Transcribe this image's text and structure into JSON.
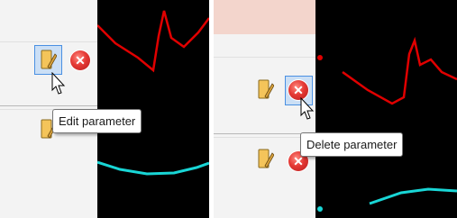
{
  "left": {
    "edit_icon": "pencil-edit-icon",
    "delete_icon": "delete-x-icon",
    "tooltip": "Edit parameter"
  },
  "right": {
    "edit_icon": "pencil-edit-icon",
    "delete_icon": "delete-x-icon",
    "tooltip": "Delete parameter"
  },
  "colors": {
    "signal_red": "#e00000",
    "signal_cyan": "#19d6d6",
    "plot_background": "#000000",
    "sidebar_background": "#f3f3f3",
    "top_banner": "#f3d5cc"
  }
}
